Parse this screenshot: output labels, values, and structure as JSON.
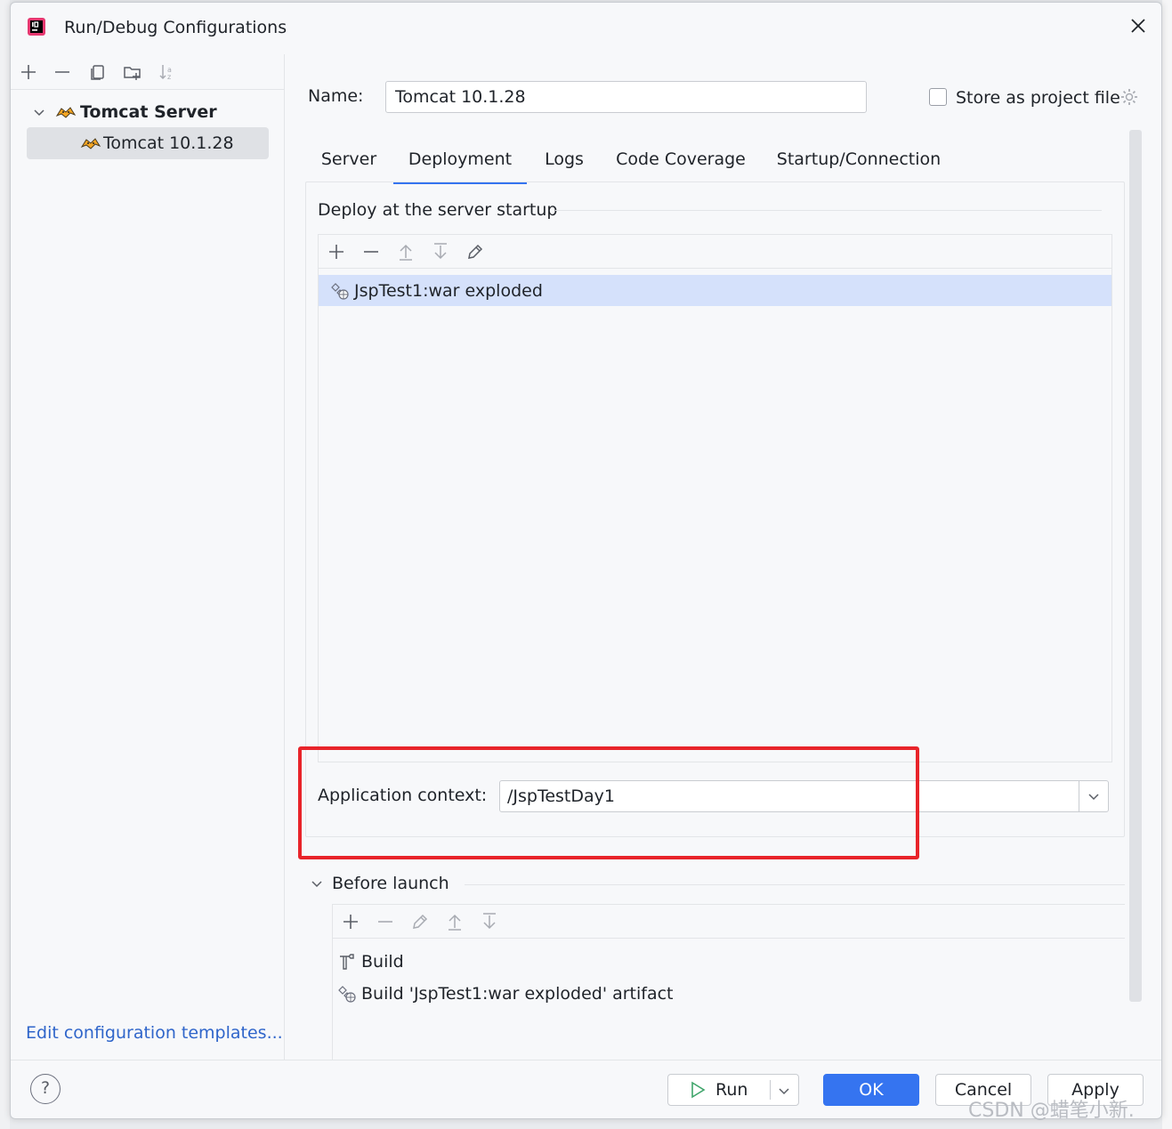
{
  "window": {
    "title": "Run/Debug Configurations"
  },
  "left": {
    "tree": [
      {
        "label": "Tomcat Server",
        "expanded": true
      },
      {
        "label": "Tomcat 10.1.28",
        "selected": true
      }
    ],
    "edit_templates_link": "Edit configuration templates..."
  },
  "name_field": {
    "label": "Name:",
    "value": "Tomcat 10.1.28"
  },
  "store_project_file": {
    "label": "Store as project file",
    "checked": false
  },
  "tabs": [
    {
      "label": "Server"
    },
    {
      "label": "Deployment",
      "active": true
    },
    {
      "label": "Logs"
    },
    {
      "label": "Code Coverage"
    },
    {
      "label": "Startup/Connection"
    }
  ],
  "deployment": {
    "section_title": "Deploy at the server startup",
    "artifacts": [
      {
        "label": "JspTest1:war exploded"
      }
    ],
    "application_context_label": "Application context:",
    "application_context_value": "/JspTestDay1"
  },
  "before_launch": {
    "label": "Before launch",
    "tasks": [
      {
        "label": "Build",
        "icon": "hammer-icon"
      },
      {
        "label": "Build 'JspTest1:war exploded' artifact",
        "icon": "artifact-icon"
      }
    ]
  },
  "buttons": {
    "help": "?",
    "run": "Run",
    "ok": "OK",
    "cancel": "Cancel",
    "apply": "Apply"
  },
  "watermark": "CSDN @蜡笔小新.",
  "colors": {
    "accent": "#3574f0",
    "selection": "#d5e1fb",
    "highlight_box": "#e8242a",
    "link": "#2f65ca"
  }
}
